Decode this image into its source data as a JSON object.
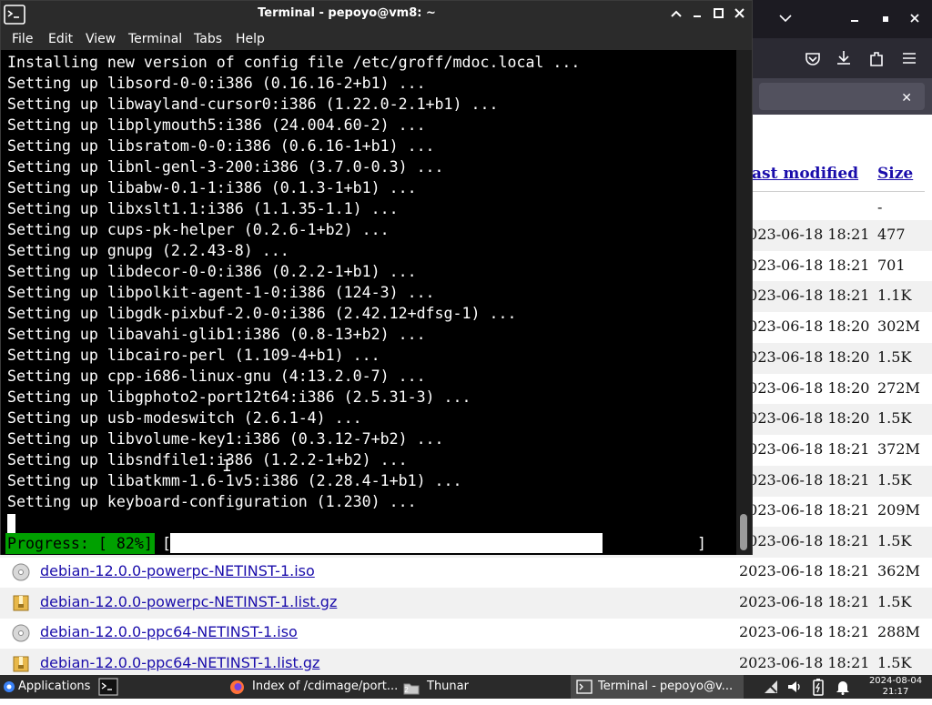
{
  "terminal": {
    "title": "Terminal - pepoyo@vm8: ~",
    "menu": [
      "File",
      "Edit",
      "View",
      "Terminal",
      "Tabs",
      "Help"
    ],
    "lines": [
      "Installing new version of config file /etc/groff/mdoc.local ...",
      "Setting up libsord-0-0:i386 (0.16.16-2+b1) ...",
      "Setting up libwayland-cursor0:i386 (1.22.0-2.1+b1) ...",
      "Setting up libplymouth5:i386 (24.004.60-2) ...",
      "Setting up libsratom-0-0:i386 (0.6.16-1+b1) ...",
      "Setting up libnl-genl-3-200:i386 (3.7.0-0.3) ...",
      "Setting up libabw-0.1-1:i386 (0.1.3-1+b1) ...",
      "Setting up libxslt1.1:i386 (1.1.35-1.1) ...",
      "Setting up cups-pk-helper (0.2.6-1+b2) ...",
      "Setting up gnupg (2.2.43-8) ...",
      "Setting up libdecor-0-0:i386 (0.2.2-1+b1) ...",
      "Setting up libpolkit-agent-1-0:i386 (124-3) ...",
      "Setting up libgdk-pixbuf-2.0-0:i386 (2.42.12+dfsg-1) ...",
      "Setting up libavahi-glib1:i386 (0.8-13+b2) ...",
      "Setting up libcairo-perl (1.109-4+b1) ...",
      "Setting up cpp-i686-linux-gnu (4:13.2.0-7) ...",
      "Setting up libgphoto2-port12t64:i386 (2.5.31-3) ...",
      "Setting up usb-modeswitch (2.6.1-4) ...",
      "Setting up libvolume-key1:i386 (0.3.12-7+b2) ...",
      "Setting up libsndfile1:i386 (1.2.2-1+b2) ...",
      "Setting up libatkmm-1.6-1v5:i386 (2.28.4-1+b1) ...",
      "Setting up keyboard-configuration (1.230) ..."
    ],
    "progress_label": "Progress: [ 82%]",
    "progress_open": "[",
    "progress_close": "]",
    "progress_fraction": 0.82
  },
  "listing": {
    "header_last_modified": "ast modified",
    "header_size": "Size",
    "parent_size": "-",
    "rows_behind": [
      {
        "date": "2023-06-18 18:21",
        "size": "477"
      },
      {
        "date": "2023-06-18 18:21",
        "size": "701"
      },
      {
        "date": "2023-06-18 18:21",
        "size": "1.1K"
      },
      {
        "date": "2023-06-18 18:20",
        "size": "302M"
      },
      {
        "date": "2023-06-18 18:20",
        "size": "1.5K"
      },
      {
        "date": "2023-06-18 18:20",
        "size": "272M"
      },
      {
        "date": "2023-06-18 18:20",
        "size": "1.5K"
      },
      {
        "date": "2023-06-18 18:21",
        "size": "372M"
      },
      {
        "date": "2023-06-18 18:21",
        "size": "1.5K"
      },
      {
        "date": "2023-06-18 18:21",
        "size": "209M"
      },
      {
        "date": "2023-06-18 18:21",
        "size": "1.5K"
      }
    ],
    "rows_visible": [
      {
        "name": "debian-12.0.0-powerpc-NETINST-1.iso",
        "date": "2023-06-18 18:21",
        "size": "362M",
        "icon": "disc-icon"
      },
      {
        "name": "debian-12.0.0-powerpc-NETINST-1.list.gz",
        "date": "2023-06-18 18:21",
        "size": "1.5K",
        "icon": "archive-icon"
      },
      {
        "name": "debian-12.0.0-ppc64-NETINST-1.iso",
        "date": "2023-06-18 18:21",
        "size": "288M",
        "icon": "disc-icon"
      },
      {
        "name": "debian-12.0.0-ppc64-NETINST-1.list.gz",
        "date": "2023-06-18 18:21",
        "size": "1.5K",
        "icon": "archive-icon"
      }
    ]
  },
  "taskbar": {
    "applications_label": "Applications",
    "tasks": [
      {
        "label": "Index of /cdimage/port...",
        "icon": "firefox-icon"
      },
      {
        "label": "Thunar",
        "icon": "folder-icon"
      },
      {
        "label": "Terminal - pepoyo@v...",
        "icon": "terminal-icon"
      }
    ],
    "clock_date": "2024-08-04",
    "clock_time": "21:17",
    "notif_count": "2"
  },
  "colors": {
    "terminal_bg": "#000000",
    "progress_green": "#00a000",
    "link_blue": "#1a0dab",
    "titlebar": "#2b2b2b",
    "firefox_chrome": "#2b2a33"
  }
}
